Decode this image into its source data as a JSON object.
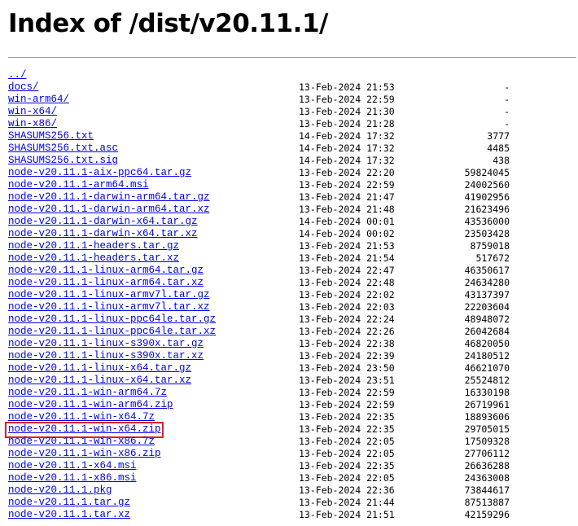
{
  "header": {
    "title": "Index of /dist/v20.11.1/"
  },
  "listing": [
    {
      "name": "../",
      "date": "",
      "size": ""
    },
    {
      "name": "docs/",
      "date": "13-Feb-2024 21:53",
      "size": "-"
    },
    {
      "name": "win-arm64/",
      "date": "13-Feb-2024 22:59",
      "size": "-"
    },
    {
      "name": "win-x64/",
      "date": "13-Feb-2024 21:30",
      "size": "-"
    },
    {
      "name": "win-x86/",
      "date": "13-Feb-2024 21:28",
      "size": "-"
    },
    {
      "name": "SHASUMS256.txt",
      "date": "14-Feb-2024 17:32",
      "size": "3777"
    },
    {
      "name": "SHASUMS256.txt.asc",
      "date": "14-Feb-2024 17:32",
      "size": "4485"
    },
    {
      "name": "SHASUMS256.txt.sig",
      "date": "14-Feb-2024 17:32",
      "size": "438"
    },
    {
      "name": "node-v20.11.1-aix-ppc64.tar.gz",
      "date": "13-Feb-2024 22:20",
      "size": "59824045"
    },
    {
      "name": "node-v20.11.1-arm64.msi",
      "date": "13-Feb-2024 22:59",
      "size": "24002560"
    },
    {
      "name": "node-v20.11.1-darwin-arm64.tar.gz",
      "date": "13-Feb-2024 21:47",
      "size": "41902956"
    },
    {
      "name": "node-v20.11.1-darwin-arm64.tar.xz",
      "date": "13-Feb-2024 21:48",
      "size": "21623496"
    },
    {
      "name": "node-v20.11.1-darwin-x64.tar.gz",
      "date": "14-Feb-2024 00:01",
      "size": "43536000"
    },
    {
      "name": "node-v20.11.1-darwin-x64.tar.xz",
      "date": "14-Feb-2024 00:02",
      "size": "23503428"
    },
    {
      "name": "node-v20.11.1-headers.tar.gz",
      "date": "13-Feb-2024 21:53",
      "size": "8759018"
    },
    {
      "name": "node-v20.11.1-headers.tar.xz",
      "date": "13-Feb-2024 21:54",
      "size": "517672"
    },
    {
      "name": "node-v20.11.1-linux-arm64.tar.gz",
      "date": "13-Feb-2024 22:47",
      "size": "46350617"
    },
    {
      "name": "node-v20.11.1-linux-arm64.tar.xz",
      "date": "13-Feb-2024 22:48",
      "size": "24634280"
    },
    {
      "name": "node-v20.11.1-linux-armv7l.tar.gz",
      "date": "13-Feb-2024 22:02",
      "size": "43137397"
    },
    {
      "name": "node-v20.11.1-linux-armv7l.tar.xz",
      "date": "13-Feb-2024 22:03",
      "size": "22203604"
    },
    {
      "name": "node-v20.11.1-linux-ppc64le.tar.gz",
      "date": "13-Feb-2024 22:24",
      "size": "48948072"
    },
    {
      "name": "node-v20.11.1-linux-ppc64le.tar.xz",
      "date": "13-Feb-2024 22:26",
      "size": "26042684"
    },
    {
      "name": "node-v20.11.1-linux-s390x.tar.gz",
      "date": "13-Feb-2024 22:38",
      "size": "46820050"
    },
    {
      "name": "node-v20.11.1-linux-s390x.tar.xz",
      "date": "13-Feb-2024 22:39",
      "size": "24180512"
    },
    {
      "name": "node-v20.11.1-linux-x64.tar.gz",
      "date": "13-Feb-2024 23:50",
      "size": "46621070"
    },
    {
      "name": "node-v20.11.1-linux-x64.tar.xz",
      "date": "13-Feb-2024 23:51",
      "size": "25524812"
    },
    {
      "name": "node-v20.11.1-win-arm64.7z",
      "date": "13-Feb-2024 22:59",
      "size": "16330198"
    },
    {
      "name": "node-v20.11.1-win-arm64.zip",
      "date": "13-Feb-2024 22:59",
      "size": "26719961"
    },
    {
      "name": "node-v20.11.1-win-x64.7z",
      "date": "13-Feb-2024 22:35",
      "size": "18893606"
    },
    {
      "name": "node-v20.11.1-win-x64.zip",
      "date": "13-Feb-2024 22:35",
      "size": "29705015",
      "highlighted": true
    },
    {
      "name": "node-v20.11.1-win-x86.7z",
      "date": "13-Feb-2024 22:05",
      "size": "17509328"
    },
    {
      "name": "node-v20.11.1-win-x86.zip",
      "date": "13-Feb-2024 22:05",
      "size": "27706112"
    },
    {
      "name": "node-v20.11.1-x64.msi",
      "date": "13-Feb-2024 22:35",
      "size": "26636288"
    },
    {
      "name": "node-v20.11.1-x86.msi",
      "date": "13-Feb-2024 22:05",
      "size": "24363008"
    },
    {
      "name": "node-v20.11.1.pkg",
      "date": "13-Feb-2024 22:36",
      "size": "73844617"
    },
    {
      "name": "node-v20.11.1.tar.gz",
      "date": "13-Feb-2024 21:44",
      "size": "87513887"
    },
    {
      "name": "node-v20.11.1.tar.xz",
      "date": "13-Feb-2024 21:51",
      "size": "42159296"
    }
  ],
  "colors": {
    "link": "#0000ee",
    "highlight_border": "#e02020",
    "divider": "#9a9a9a"
  }
}
